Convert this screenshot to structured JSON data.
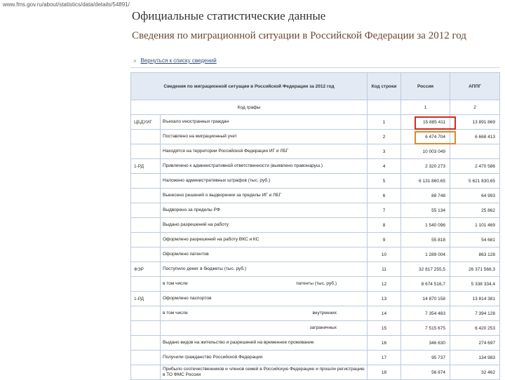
{
  "url": "www.fms.gov.ru/about/statistics/data/details/54891/",
  "page_title": "Официальные статистические данные",
  "subtitle": "Сведения по миграционной ситуации в Российской Федерации за 2012 год",
  "back_link": "Вернуться к списку сведений",
  "colors": {
    "marker_red": "#d22a1e",
    "marker_orange": "#e58624",
    "header_bg": "#e4eaf4"
  },
  "table": {
    "headers": {
      "indicator": "Сведения по миграционной ситуации в Российской Федерации за 2012 год",
      "line": "Код строки",
      "russia": "Россия",
      "total": "АППГ"
    },
    "subheader": {
      "label": "Код графы",
      "line": "",
      "russia": "1",
      "total": "2"
    },
    "rows": [
      {
        "code": "ЦБДУИГ",
        "indicator": "Въехало иностранных граждан",
        "extra": "",
        "line": "1",
        "russia": "15 885 411",
        "total": "13 891 869"
      },
      {
        "code": "",
        "indicator": "Поставлено на миграционный учет",
        "extra": "",
        "line": "2",
        "russia": "6 474 704",
        "total": "6 668 413"
      },
      {
        "code": "",
        "indicator": "Находятся на территории Российской Федерации ИГ и ЛБГ",
        "extra": "",
        "line": "3",
        "russia": "10 003 049",
        "total": ""
      },
      {
        "code": "1-РД",
        "indicator": "Привлечено к административной ответственности (выявлено правонаруш.)",
        "extra": "",
        "line": "4",
        "russia": "2 320 273",
        "total": "2 470 586"
      },
      {
        "code": "",
        "indicator": "Наложено административных штрафов (тыс. руб.)",
        "extra": "",
        "line": "5",
        "russia": "6 131 860,65",
        "total": "5 621 830,65"
      },
      {
        "code": "",
        "indicator": "Вынесено решений о выдворении за пределы ИГ и ЛБГ",
        "extra": "",
        "line": "6",
        "russia": "88 748",
        "total": "64 993"
      },
      {
        "code": "",
        "indicator": "Выдворено за пределы РФ",
        "extra": "",
        "line": "7",
        "russia": "55 134",
        "total": "25 862"
      },
      {
        "code": "",
        "indicator": "Выдано разрешений на работу",
        "extra": "",
        "line": "8",
        "russia": "1 540 096",
        "total": "1 101 469"
      },
      {
        "code": "",
        "indicator": "Оформлено разрешений на работу ВКС и КС",
        "extra": "",
        "line": "9",
        "russia": "55 818",
        "total": "54 681"
      },
      {
        "code": "",
        "indicator": "Оформлено патентов",
        "extra": "",
        "line": "10",
        "russia": "1 289 004",
        "total": "863 128"
      },
      {
        "code": "ФЭР",
        "indicator": "Поступило денег в бюджеты (тыс. руб.)",
        "extra": "",
        "line": "11",
        "russia": "32 817 255,5",
        "total": "26 371 566,3"
      },
      {
        "code": "",
        "indicator": "в том числе",
        "extra": "патенты (тыс. руб.)",
        "line": "12",
        "russia": "8 674 516,7",
        "total": "5 338 334,4"
      },
      {
        "code": "1-РД",
        "indicator": "Оформлено паспортов",
        "extra": "",
        "line": "13",
        "russia": "14 870 158",
        "total": "13 814 381"
      },
      {
        "code": "",
        "indicator": "в том числе",
        "extra": "внутренних",
        "line": "14",
        "russia": "7 354 483",
        "total": "7 394 128"
      },
      {
        "code": "",
        "indicator": "",
        "extra": "заграничных",
        "line": "15",
        "russia": "7 515 675",
        "total": "6 420 253"
      },
      {
        "code": "",
        "indicator": "Выдано видов на жительство и разрешений на временное проживание",
        "extra": "",
        "line": "16",
        "russia": "346 630",
        "total": "274 697"
      },
      {
        "code": "",
        "indicator": "Получили гражданство Российской Федерации",
        "extra": "",
        "line": "17",
        "russia": "95 737",
        "total": "134 983"
      },
      {
        "code": "",
        "indicator": "Прибыло соотечественников и членов семей в Российскую Федерацию и прошли регистрацию в ТО ФМС России",
        "extra": "",
        "line": "18",
        "russia": "56 874",
        "total": "32 462"
      }
    ]
  }
}
